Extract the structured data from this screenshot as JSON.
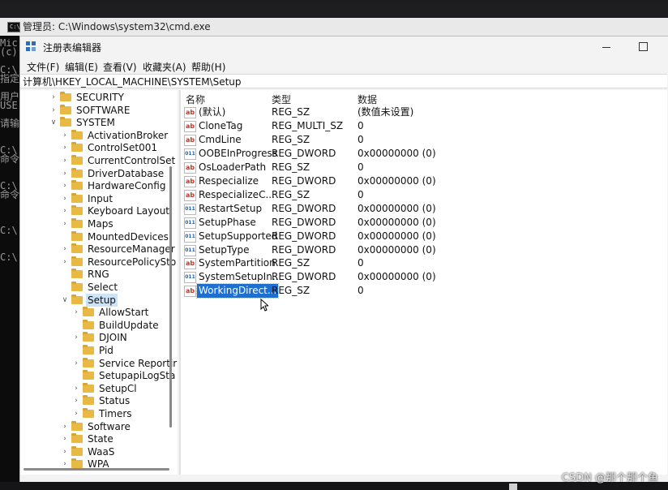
{
  "cmd": {
    "title": "管理员: C:\\Windows\\system32\\cmd.exe",
    "text_lines": [
      "Mic",
      "(c)",
      "",
      "C:\\",
      "指定",
      "",
      "用户",
      "USE",
      "",
      "请输",
      "",
      "",
      "C:\\",
      "命令",
      "",
      "",
      "C:\\",
      "命令",
      "",
      "",
      "",
      "C:\\",
      "",
      "",
      "C:\\"
    ]
  },
  "regedit": {
    "title": "注册表编辑器",
    "menu": [
      "文件(F)",
      "编辑(E)",
      "查看(V)",
      "收藏夹(A)",
      "帮助(H)"
    ],
    "address": "计算机\\HKEY_LOCAL_MACHINE\\SYSTEM\\Setup",
    "tree": [
      {
        "label": "SECURITY",
        "level": 1,
        "chevron": "right"
      },
      {
        "label": "SOFTWARE",
        "level": 1,
        "chevron": "right"
      },
      {
        "label": "SYSTEM",
        "level": 1,
        "chevron": "down"
      },
      {
        "label": "ActivationBroker",
        "level": 2,
        "chevron": "right"
      },
      {
        "label": "ControlSet001",
        "level": 2,
        "chevron": "right"
      },
      {
        "label": "CurrentControlSet",
        "level": 2,
        "chevron": "right"
      },
      {
        "label": "DriverDatabase",
        "level": 2,
        "chevron": "right"
      },
      {
        "label": "HardwareConfig",
        "level": 2,
        "chevron": "right"
      },
      {
        "label": "Input",
        "level": 2,
        "chevron": "right"
      },
      {
        "label": "Keyboard Layout",
        "level": 2,
        "chevron": "right"
      },
      {
        "label": "Maps",
        "level": 2,
        "chevron": "right"
      },
      {
        "label": "MountedDevices",
        "level": 2,
        "chevron": ""
      },
      {
        "label": "ResourceManager",
        "level": 2,
        "chevron": "right"
      },
      {
        "label": "ResourcePolicySto",
        "level": 2,
        "chevron": "right"
      },
      {
        "label": "RNG",
        "level": 2,
        "chevron": ""
      },
      {
        "label": "Select",
        "level": 2,
        "chevron": ""
      },
      {
        "label": "Setup",
        "level": 2,
        "chevron": "down",
        "selected": true
      },
      {
        "label": "AllowStart",
        "level": 3,
        "chevron": "right"
      },
      {
        "label": "BuildUpdate",
        "level": 3,
        "chevron": ""
      },
      {
        "label": "DJOIN",
        "level": 3,
        "chevron": "right"
      },
      {
        "label": "Pid",
        "level": 3,
        "chevron": ""
      },
      {
        "label": "Service Reportir",
        "level": 3,
        "chevron": "right"
      },
      {
        "label": "SetupapiLogSta",
        "level": 3,
        "chevron": ""
      },
      {
        "label": "SetupCl",
        "level": 3,
        "chevron": "right"
      },
      {
        "label": "Status",
        "level": 3,
        "chevron": "right"
      },
      {
        "label": "Timers",
        "level": 3,
        "chevron": "right"
      },
      {
        "label": "Software",
        "level": 2,
        "chevron": "right"
      },
      {
        "label": "State",
        "level": 2,
        "chevron": "right"
      },
      {
        "label": "WaaS",
        "level": 2,
        "chevron": "right"
      },
      {
        "label": "WPA",
        "level": 2,
        "chevron": "right"
      }
    ],
    "columns": {
      "name": "名称",
      "type": "类型",
      "data": "数据"
    },
    "values": [
      {
        "name": "(默认)",
        "type": "REG_SZ",
        "data": "(数值未设置)",
        "icon": "sz"
      },
      {
        "name": "CloneTag",
        "type": "REG_MULTI_SZ",
        "data": "0",
        "icon": "sz"
      },
      {
        "name": "CmdLine",
        "type": "REG_SZ",
        "data": "0",
        "icon": "sz"
      },
      {
        "name": "OOBEInProgress",
        "type": "REG_DWORD",
        "data": "0x00000000 (0)",
        "icon": "bin"
      },
      {
        "name": "OsLoaderPath",
        "type": "REG_SZ",
        "data": "0",
        "icon": "sz"
      },
      {
        "name": "Respecialize",
        "type": "REG_DWORD",
        "data": "0x00000000 (0)",
        "icon": "sz"
      },
      {
        "name": "RespecializeC...",
        "type": "REG_SZ",
        "data": "0",
        "icon": "sz"
      },
      {
        "name": "RestartSetup",
        "type": "REG_DWORD",
        "data": "0x00000000 (0)",
        "icon": "bin"
      },
      {
        "name": "SetupPhase",
        "type": "REG_DWORD",
        "data": "0x00000000 (0)",
        "icon": "bin"
      },
      {
        "name": "SetupSupported",
        "type": "REG_DWORD",
        "data": "0x00000000 (0)",
        "icon": "bin"
      },
      {
        "name": "SetupType",
        "type": "REG_DWORD",
        "data": "0x00000000 (0)",
        "icon": "bin"
      },
      {
        "name": "SystemPartition",
        "type": "REG_SZ",
        "data": "0",
        "icon": "sz"
      },
      {
        "name": "SystemSetupIn...",
        "type": "REG_DWORD",
        "data": "0x00000000 (0)",
        "icon": "bin"
      },
      {
        "name": "WorkingDirect...",
        "type": "REG_SZ",
        "data": "0",
        "icon": "sz",
        "selected": true
      }
    ],
    "icon_glyphs": {
      "sz": "ab",
      "bin": "011"
    }
  },
  "watermark": "CSDN @那个那个鱼"
}
